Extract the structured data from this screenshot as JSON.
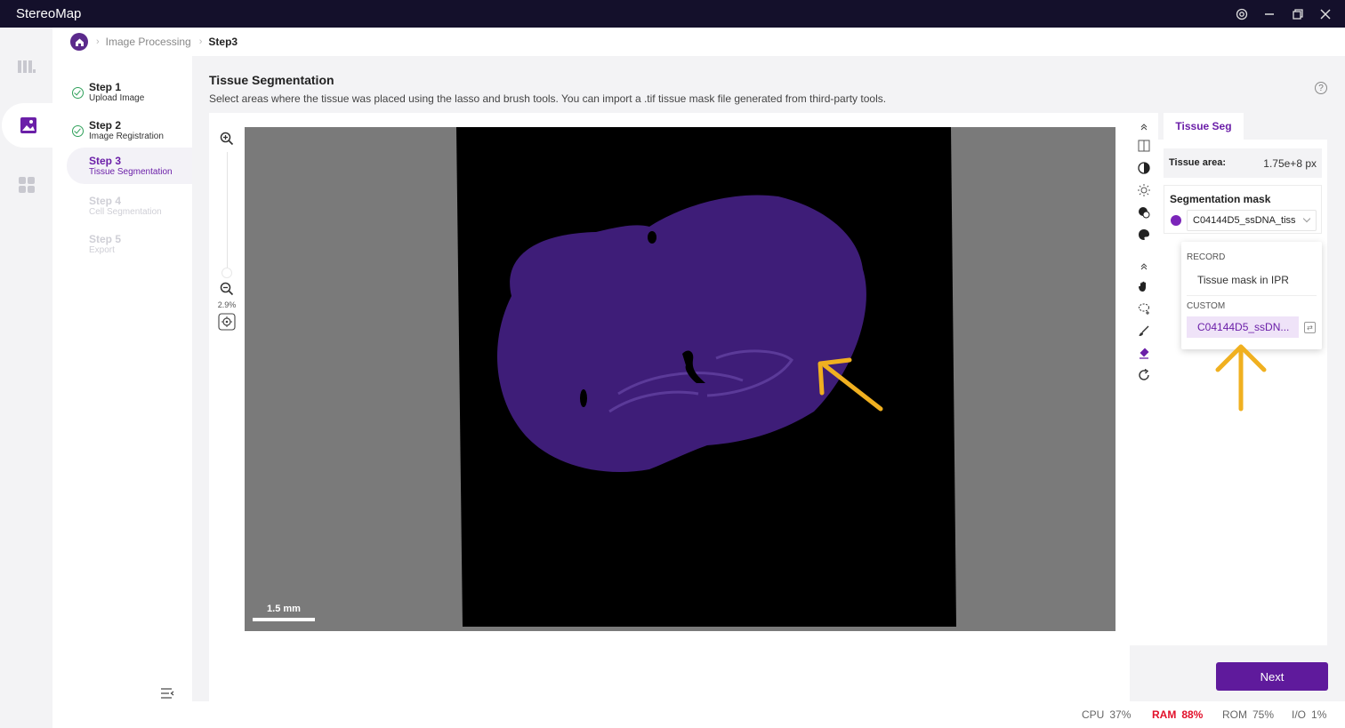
{
  "app": {
    "title": "StereoMap"
  },
  "breadcrumb": {
    "items": [
      "Image Processing",
      "Step3"
    ]
  },
  "steps": [
    {
      "title": "Step 1",
      "subtitle": "Upload Image",
      "state": "done"
    },
    {
      "title": "Step 2",
      "subtitle": "Image Registration",
      "state": "done"
    },
    {
      "title": "Step 3",
      "subtitle": "Tissue Segmentation",
      "state": "active"
    },
    {
      "title": "Step 4",
      "subtitle": "Cell Segmentation",
      "state": "disabled"
    },
    {
      "title": "Step 5",
      "subtitle": "Export",
      "state": "disabled"
    }
  ],
  "main": {
    "title": "Tissue Segmentation",
    "description": "Select areas where the tissue was placed using the lasso and brush tools. You can import a .tif tissue mask file generated from third-party tools."
  },
  "viewer": {
    "zoom_level": "2.9%",
    "scale_label": "1.5 mm"
  },
  "panel": {
    "tab": "Tissue Seg",
    "tissue_area_label": "Tissue area:",
    "tissue_area_value": "1.75e+8 px",
    "mask_label": "Segmentation mask",
    "mask_value": "C04144D5_ssDNA_tiss"
  },
  "dropdown": {
    "record_header": "RECORD",
    "record_item": "Tissue mask in IPR",
    "custom_header": "CUSTOM",
    "custom_item": "C04144D5_ssDN..."
  },
  "actions": {
    "next": "Next"
  },
  "status": {
    "cpu_label": "CPU",
    "cpu_value": "37%",
    "ram_label": "RAM",
    "ram_value": "88%",
    "rom_label": "ROM",
    "rom_value": "75%",
    "io_label": "I/O",
    "io_value": "1%"
  },
  "colors": {
    "accent": "#6b1fa8",
    "titlebar": "#14102b",
    "ram_alert": "#e2102a",
    "tissue": "#3e1d78",
    "arrow": "#f0b020"
  },
  "icons": [
    "home-icon",
    "zoom-in-icon",
    "zoom-out-icon",
    "recenter-icon",
    "contrast-icon",
    "brightness-icon",
    "color-icon",
    "palette-icon",
    "hand-icon",
    "lasso-icon",
    "brush-icon",
    "eraser-icon",
    "rotate-icon",
    "settings-icon"
  ]
}
